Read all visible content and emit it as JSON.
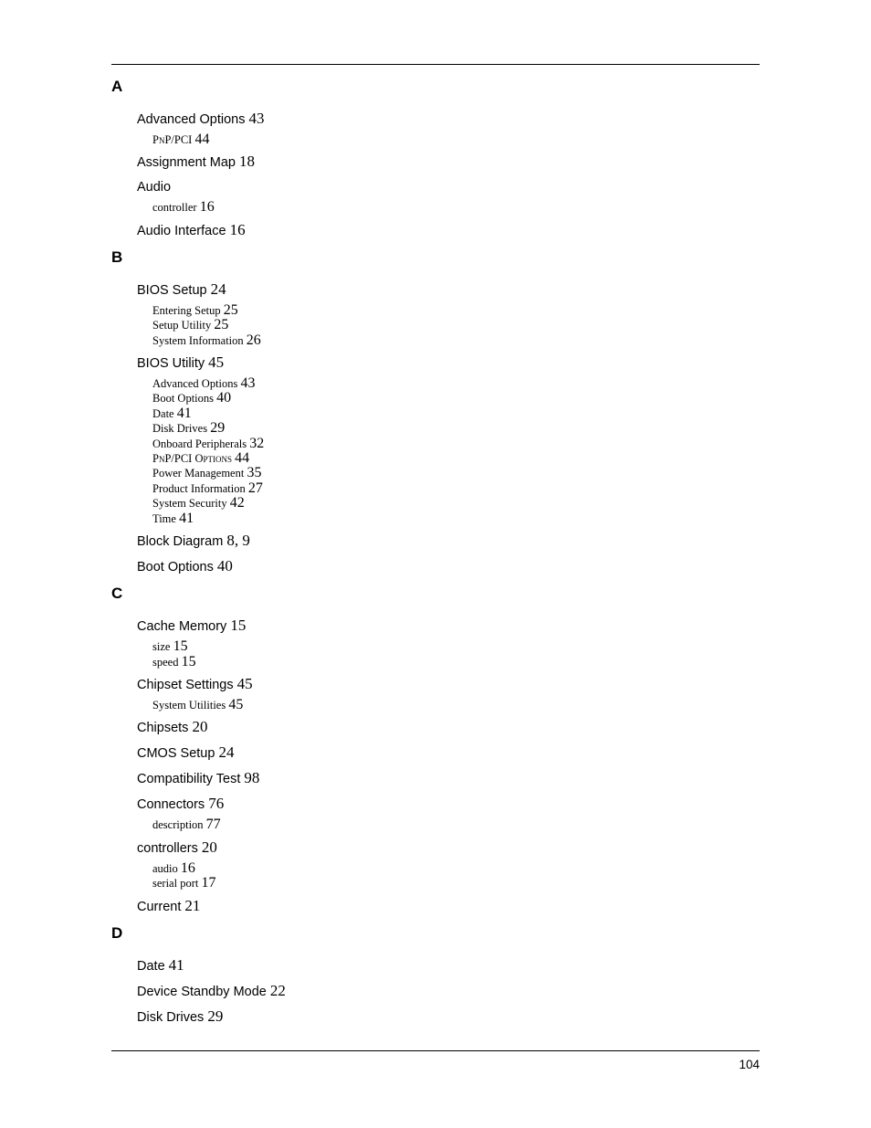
{
  "document": {
    "page_number": "104",
    "sections": [
      {
        "letter": "A",
        "entries": [
          {
            "title": "Advanced Options",
            "pages": "43",
            "subentries": [
              {
                "title": "PnP/PCI",
                "pages": "44",
                "smallcaps": true
              }
            ]
          },
          {
            "title": "Assignment Map",
            "pages": "18",
            "subentries": []
          },
          {
            "title": "Audio",
            "pages": "",
            "subentries": [
              {
                "title": "controller",
                "pages": "16"
              }
            ]
          },
          {
            "title": "Audio Interface",
            "pages": "16",
            "subentries": []
          }
        ]
      },
      {
        "letter": "B",
        "entries": [
          {
            "title": "BIOS Setup",
            "pages": "24",
            "subentries": [
              {
                "title": "Entering Setup",
                "pages": "25"
              },
              {
                "title": "Setup Utility",
                "pages": "25"
              },
              {
                "title": "System Information",
                "pages": "26"
              }
            ]
          },
          {
            "title": "BIOS Utility",
            "pages": "45",
            "subentries": [
              {
                "title": "Advanced Options",
                "pages": "43"
              },
              {
                "title": "Boot Options",
                "pages": "40"
              },
              {
                "title": "Date",
                "pages": "41"
              },
              {
                "title": "Disk Drives",
                "pages": "29"
              },
              {
                "title": "Onboard Peripherals",
                "pages": "32"
              },
              {
                "title": "PnP/PCI Options",
                "pages": "44",
                "smallcaps": true
              },
              {
                "title": "Power Management",
                "pages": "35"
              },
              {
                "title": "Product Information",
                "pages": "27"
              },
              {
                "title": "System Security",
                "pages": "42"
              },
              {
                "title": "Time",
                "pages": "41"
              }
            ]
          },
          {
            "title": "Block Diagram",
            "pages": "8, 9",
            "subentries": []
          },
          {
            "title": "Boot Options",
            "pages": "40",
            "subentries": []
          }
        ]
      },
      {
        "letter": "C",
        "entries": [
          {
            "title": "Cache Memory",
            "pages": "15",
            "subentries": [
              {
                "title": "size",
                "pages": "15"
              },
              {
                "title": "speed",
                "pages": "15"
              }
            ]
          },
          {
            "title": "Chipset Settings",
            "pages": "45",
            "subentries": [
              {
                "title": "System Utilities",
                "pages": "45"
              }
            ]
          },
          {
            "title": "Chipsets",
            "pages": "20",
            "subentries": []
          },
          {
            "title": "CMOS Setup",
            "pages": "24",
            "subentries": []
          },
          {
            "title": "Compatibility Test",
            "pages": "98",
            "subentries": []
          },
          {
            "title": "Connectors",
            "pages": "76",
            "subentries": [
              {
                "title": "description",
                "pages": "77"
              }
            ]
          },
          {
            "title": "controllers",
            "pages": "20",
            "subentries": [
              {
                "title": "audio",
                "pages": "16"
              },
              {
                "title": "serial port",
                "pages": "17"
              }
            ]
          },
          {
            "title": "Current",
            "pages": "21",
            "subentries": []
          }
        ]
      },
      {
        "letter": "D",
        "entries": [
          {
            "title": "Date",
            "pages": "41",
            "subentries": []
          },
          {
            "title": "Device Standby Mode",
            "pages": "22",
            "subentries": []
          },
          {
            "title": "Disk Drives",
            "pages": "29",
            "subentries": []
          }
        ]
      }
    ]
  }
}
